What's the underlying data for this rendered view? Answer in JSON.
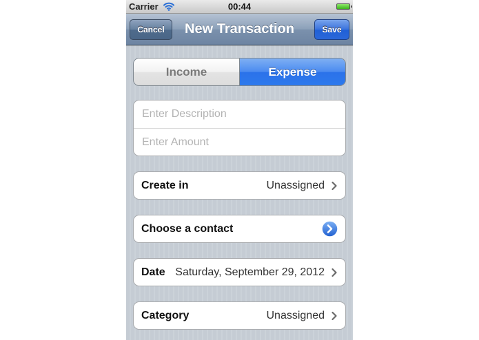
{
  "status_bar": {
    "carrier": "Carrier",
    "time": "00:44",
    "wifi_icon": "wifi-icon",
    "battery_icon": "battery-icon"
  },
  "nav": {
    "title": "New Transaction",
    "cancel_label": "Cancel",
    "save_label": "Save"
  },
  "segments": {
    "income_label": "Income",
    "expense_label": "Expense",
    "selected": "Expense"
  },
  "fields": {
    "description_value": "",
    "description_placeholder": "Enter Description",
    "amount_value": "",
    "amount_placeholder": "Enter Amount"
  },
  "rows": {
    "create_in": {
      "label": "Create in",
      "value": "Unassigned",
      "icon": "chevron-right-icon"
    },
    "contact": {
      "label": "Choose a contact",
      "icon": "detail-disclosure-icon"
    },
    "date": {
      "label": "Date",
      "value": "Saturday, September 29, 2012",
      "icon": "chevron-right-icon"
    },
    "category": {
      "label": "Category",
      "value": "Unassigned",
      "icon": "chevron-right-icon"
    }
  },
  "colors": {
    "nav_bar": "#7b91ad",
    "save_button": "#2a67d9",
    "selected_segment": "#2d79ec",
    "background": "#c5ccd4"
  }
}
